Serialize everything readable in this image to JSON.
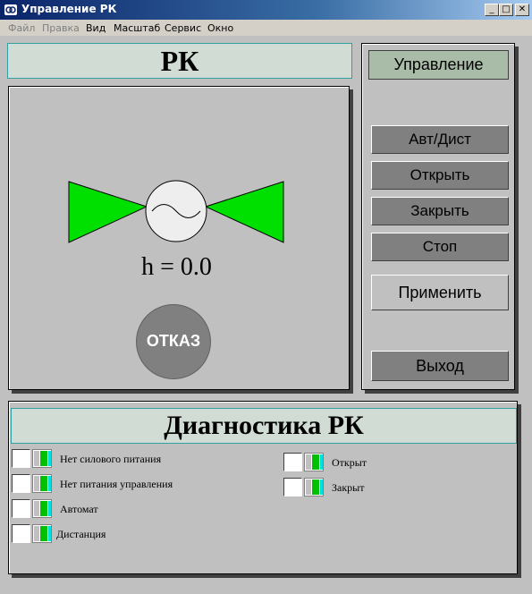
{
  "window": {
    "title": "Управление РК",
    "controls": {
      "minimize": "_",
      "maximize": "□",
      "close": "✕"
    }
  },
  "menu": [
    {
      "label": "Файл",
      "disabled": true
    },
    {
      "label": "Правка",
      "disabled": true
    },
    {
      "label": "Вид",
      "disabled": false
    },
    {
      "label": "Масштаб",
      "disabled": false
    },
    {
      "label": "Сервис",
      "disabled": false
    },
    {
      "label": "Окно",
      "disabled": false
    }
  ],
  "valve_panel": {
    "title": "РК",
    "position_text": "h = 0.0",
    "fault_label": "ОТКАЗ",
    "valve_color": "#00e000",
    "fault_color": "#808080"
  },
  "control_panel": {
    "title": "Управление",
    "buttons": {
      "auto_remote": "Авт/Дист",
      "open": "Открыть",
      "close": "Закрыть",
      "stop": "Стоп",
      "apply": "Применить",
      "exit": "Выход"
    }
  },
  "diagnostics": {
    "title": "Диагностика РК",
    "left_items": [
      {
        "label": "Нет силового питания"
      },
      {
        "label": "Нет питания управления"
      },
      {
        "label": "Автомат"
      },
      {
        "label": "Дистанция"
      }
    ],
    "right_items": [
      {
        "label": "Открыт"
      },
      {
        "label": "Закрыт"
      }
    ]
  }
}
